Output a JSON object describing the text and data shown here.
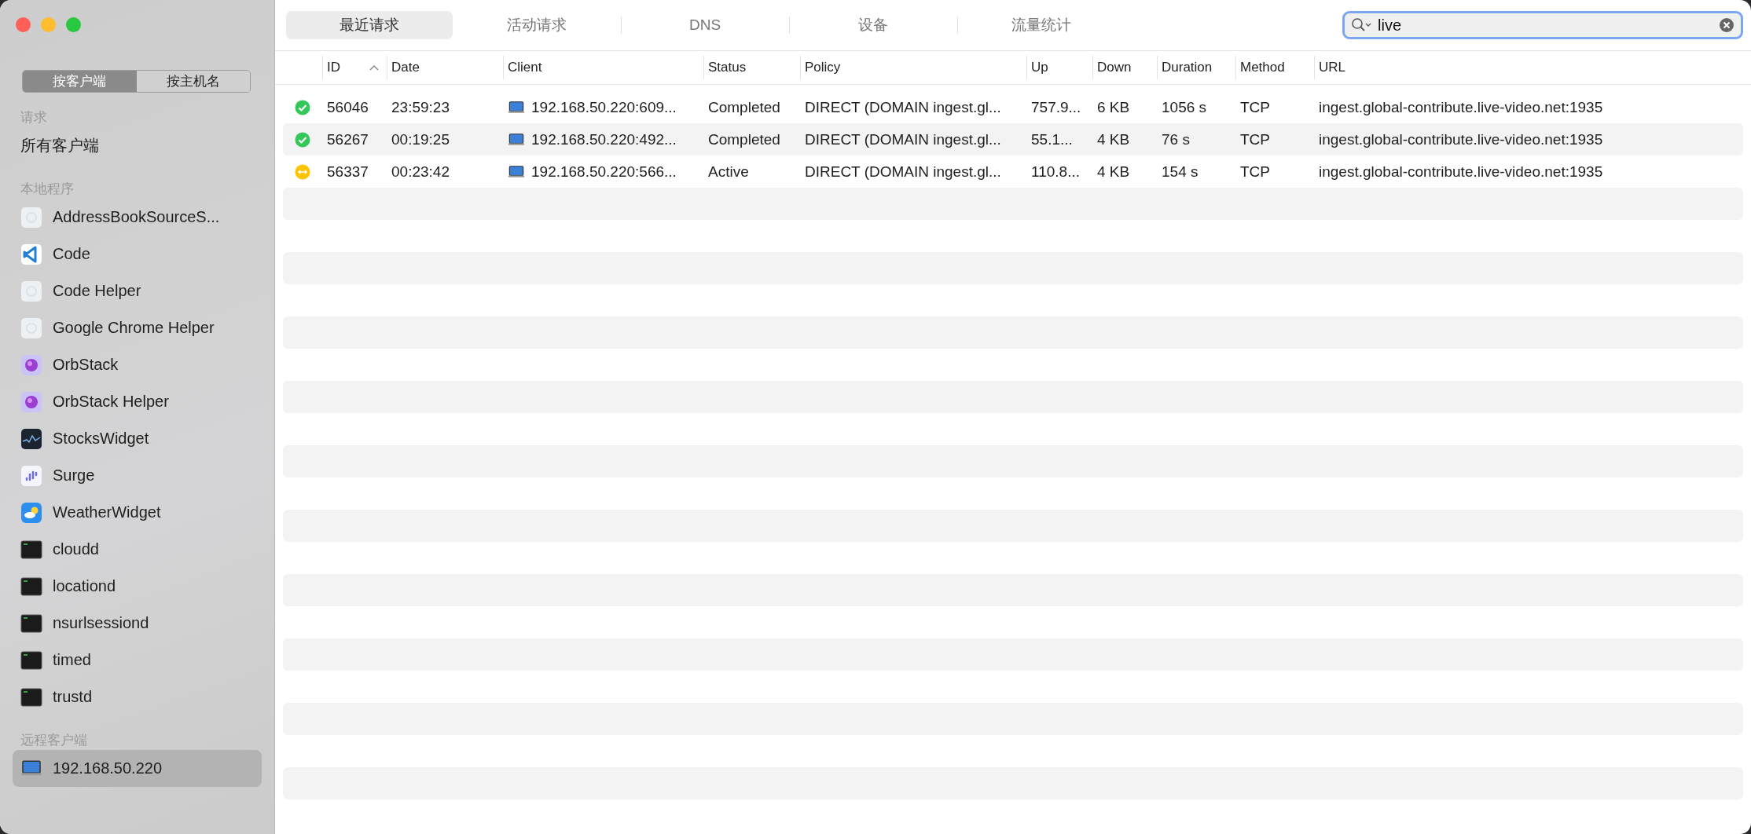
{
  "sidebar": {
    "segments": [
      {
        "label": "按客户端",
        "selected": true
      },
      {
        "label": "按主机名",
        "selected": false
      }
    ],
    "sections": [
      {
        "title": "请求",
        "items": [
          {
            "label": "所有客户端",
            "kind": "plain",
            "selected": false
          }
        ]
      },
      {
        "title": "本地程序",
        "items": [
          {
            "label": "AddressBookSourceS...",
            "kind": "generic",
            "selected": false
          },
          {
            "label": "Code",
            "kind": "editor",
            "selected": false
          },
          {
            "label": "Code Helper",
            "kind": "generic",
            "selected": false
          },
          {
            "label": "Google Chrome Helper",
            "kind": "generic",
            "selected": false
          },
          {
            "label": "OrbStack",
            "kind": "orb",
            "selected": false
          },
          {
            "label": "OrbStack Helper",
            "kind": "orb",
            "selected": false
          },
          {
            "label": "StocksWidget",
            "kind": "stocks",
            "selected": false
          },
          {
            "label": "Surge",
            "kind": "bars",
            "selected": false
          },
          {
            "label": "WeatherWidget",
            "kind": "weather",
            "selected": false
          },
          {
            "label": "cloudd",
            "kind": "terminal",
            "selected": false
          },
          {
            "label": "locationd",
            "kind": "terminal",
            "selected": false
          },
          {
            "label": "nsurlsessiond",
            "kind": "terminal",
            "selected": false
          },
          {
            "label": "timed",
            "kind": "terminal",
            "selected": false
          },
          {
            "label": "trustd",
            "kind": "terminal",
            "selected": false
          }
        ]
      },
      {
        "title": "远程客户端",
        "items": [
          {
            "label": "192.168.50.220",
            "kind": "laptop",
            "selected": true
          }
        ]
      }
    ]
  },
  "tabs": [
    {
      "label": "最近请求",
      "selected": true
    },
    {
      "label": "活动请求",
      "selected": false
    },
    {
      "label": "DNS",
      "selected": false
    },
    {
      "label": "设备",
      "selected": false
    },
    {
      "label": "流量统计",
      "selected": false
    }
  ],
  "search": {
    "value": "live"
  },
  "table": {
    "columns": [
      {
        "label": "ID",
        "sorted": true
      },
      {
        "label": "Date",
        "sorted": false
      },
      {
        "label": "Client",
        "sorted": false
      },
      {
        "label": "Status",
        "sorted": false
      },
      {
        "label": "Policy",
        "sorted": false
      },
      {
        "label": "Up",
        "sorted": false
      },
      {
        "label": "Down",
        "sorted": false
      },
      {
        "label": "Duration",
        "sorted": false
      },
      {
        "label": "Method",
        "sorted": false
      },
      {
        "label": "URL",
        "sorted": false
      }
    ],
    "rows": [
      {
        "kind": "completed",
        "cells": [
          "56046",
          "23:59:23",
          "192.168.50.220:609...",
          "Completed",
          "DIRECT (DOMAIN ingest.gl...",
          "757.9...",
          "6 KB",
          "1056 s",
          "TCP",
          "ingest.global-contribute.live-video.net:1935"
        ]
      },
      {
        "kind": "completed",
        "cells": [
          "56267",
          "00:19:25",
          "192.168.50.220:492...",
          "Completed",
          "DIRECT (DOMAIN ingest.gl...",
          "55.1...",
          "4 KB",
          "76 s",
          "TCP",
          "ingest.global-contribute.live-video.net:1935"
        ]
      },
      {
        "kind": "active",
        "cells": [
          "56337",
          "00:23:42",
          "192.168.50.220:566...",
          "Active",
          "DIRECT (DOMAIN ingest.gl...",
          "110.8...",
          "4 KB",
          "154 s",
          "TCP",
          "ingest.global-contribute.live-video.net:1935"
        ]
      }
    ]
  }
}
